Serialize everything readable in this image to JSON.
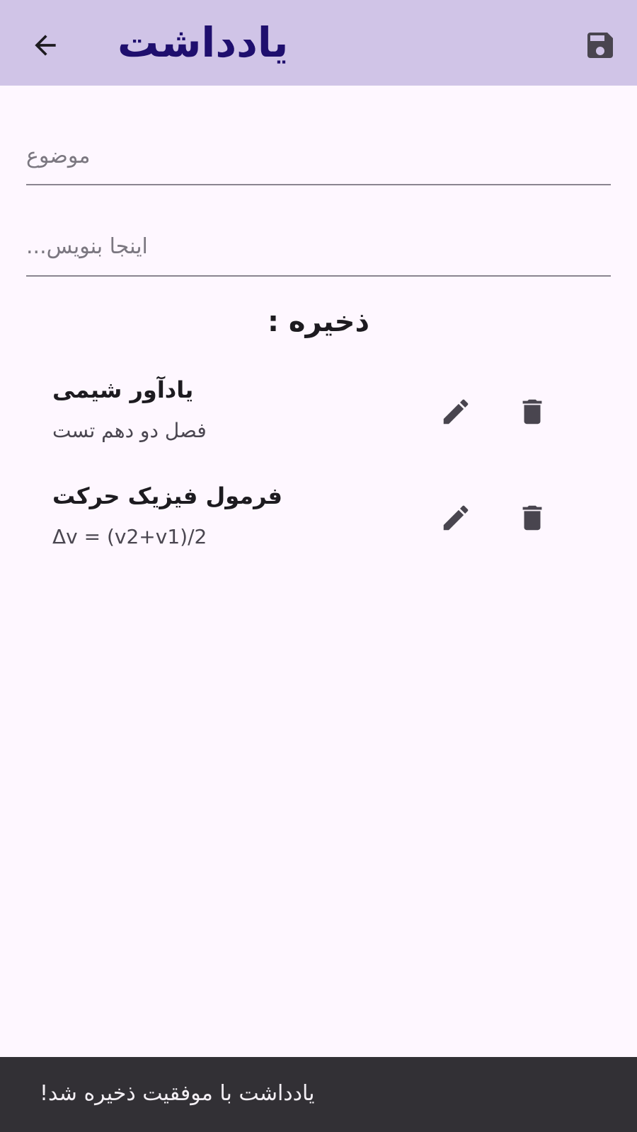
{
  "appbar": {
    "title": "یادداشت",
    "back_icon": "arrow-back-icon",
    "save_icon": "save-icon",
    "background": "#d0c4e7",
    "title_color": "#1f0f6e"
  },
  "form": {
    "subject_placeholder": "موضوع",
    "body_placeholder": "اینجا بنویس...",
    "subject_value": "",
    "body_value": ""
  },
  "saved_section": {
    "title": "ذخیره :"
  },
  "notes": [
    {
      "title": "یادآور شیمی",
      "subtitle": "فصل دو دهم تست",
      "edit_icon": "pencil-icon",
      "delete_icon": "trash-icon"
    },
    {
      "title": "فرمول فیزیک حرکت",
      "subtitle": "Δv = (v2+v1)/2",
      "edit_icon": "pencil-icon",
      "delete_icon": "trash-icon"
    }
  ],
  "snackbar": {
    "message": "یادداشت با موفقیت ذخیره شد!"
  }
}
